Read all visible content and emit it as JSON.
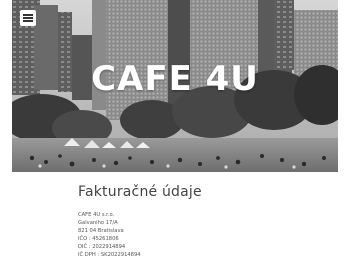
{
  "header": {
    "brand": "CAFE 4U",
    "menu_icon": "hamburger-menu-icon"
  },
  "main": {
    "heading": "Fakturačné údaje",
    "lines": [
      "CAFE 4U s.r.o.",
      "Galvaniho 17/A",
      "821 04 Bratislava",
      "IČO : 45261806",
      "DIČ : 2022914894",
      "IČ DPH : SK2022914894"
    ]
  },
  "colors": {
    "heading": "#444444",
    "text": "#555555",
    "brand_text": "#ffffff"
  }
}
